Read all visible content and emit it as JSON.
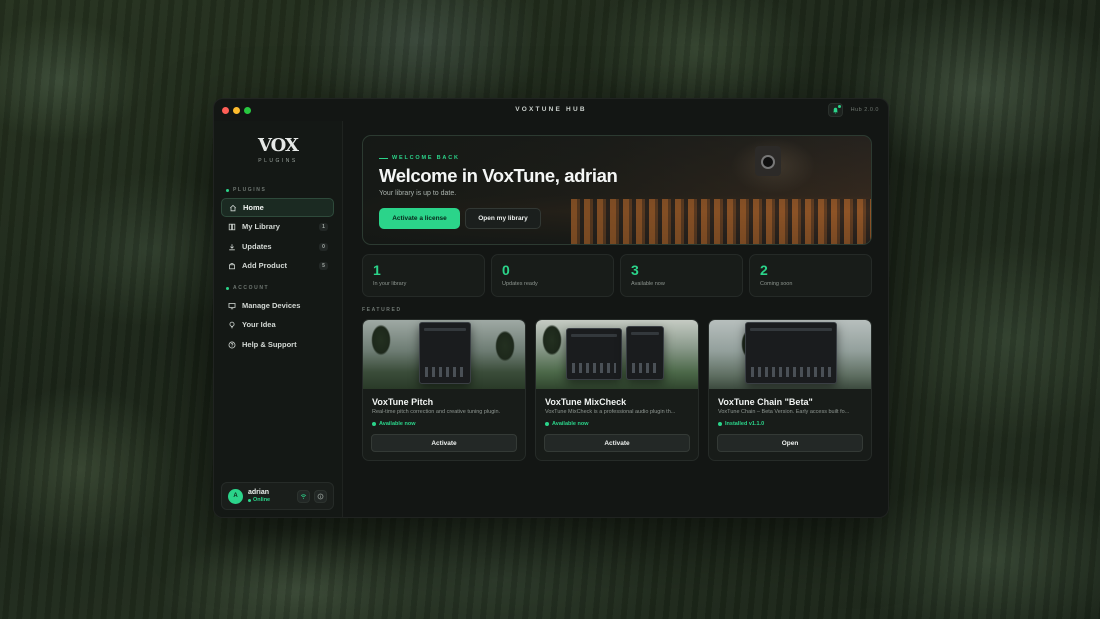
{
  "window": {
    "title": "VOXTUNE HUB",
    "version": "Hub 2.0.0"
  },
  "brand": {
    "logo": "VOX",
    "subtitle": "PLUGINS"
  },
  "sidebar": {
    "plugins_label": "PLUGINS",
    "account_label": "ACCOUNT",
    "plugin_items": [
      {
        "label": "Home",
        "icon": "home-icon",
        "count": ""
      },
      {
        "label": "My Library",
        "icon": "library-icon",
        "count": "1"
      },
      {
        "label": "Updates",
        "icon": "download-icon",
        "count": "0"
      },
      {
        "label": "Add Product",
        "icon": "bag-icon",
        "count": "5"
      }
    ],
    "account_items": [
      {
        "label": "Manage Devices",
        "icon": "monitor-icon"
      },
      {
        "label": "Your Idea",
        "icon": "lightbulb-icon"
      },
      {
        "label": "Help & Support",
        "icon": "help-icon"
      }
    ]
  },
  "user": {
    "initial": "A",
    "name": "adrian",
    "status": "Online"
  },
  "hero": {
    "eyebrow": "WELCOME BACK",
    "title": "Welcome in VoxTune, adrian",
    "subtitle": "Your library is up to date.",
    "primary_button": "Activate a license",
    "secondary_button": "Open my library"
  },
  "stats": [
    {
      "value": "1",
      "label": "In your library"
    },
    {
      "value": "0",
      "label": "Updates ready"
    },
    {
      "value": "3",
      "label": "Available now"
    },
    {
      "value": "2",
      "label": "Coming soon"
    }
  ],
  "featured": {
    "label": "FEATURED",
    "cards": [
      {
        "title": "VoxTune Pitch",
        "desc": "Real-time pitch correction and creative tuning plugin.",
        "status": "Available now",
        "button": "Activate"
      },
      {
        "title": "VoxTune MixCheck",
        "desc": "VoxTune MixCheck is a professional audio plugin th...",
        "status": "Available now",
        "button": "Activate"
      },
      {
        "title": "VoxTune Chain \"Beta\"",
        "desc": "VoxTune Chain – Beta Version. Early access built fo...",
        "status": "Installed v1.1.0",
        "button": "Open"
      }
    ]
  },
  "colors": {
    "accent": "#2bd48a",
    "window_bg": "#131614",
    "card_bg": "#181c19"
  }
}
